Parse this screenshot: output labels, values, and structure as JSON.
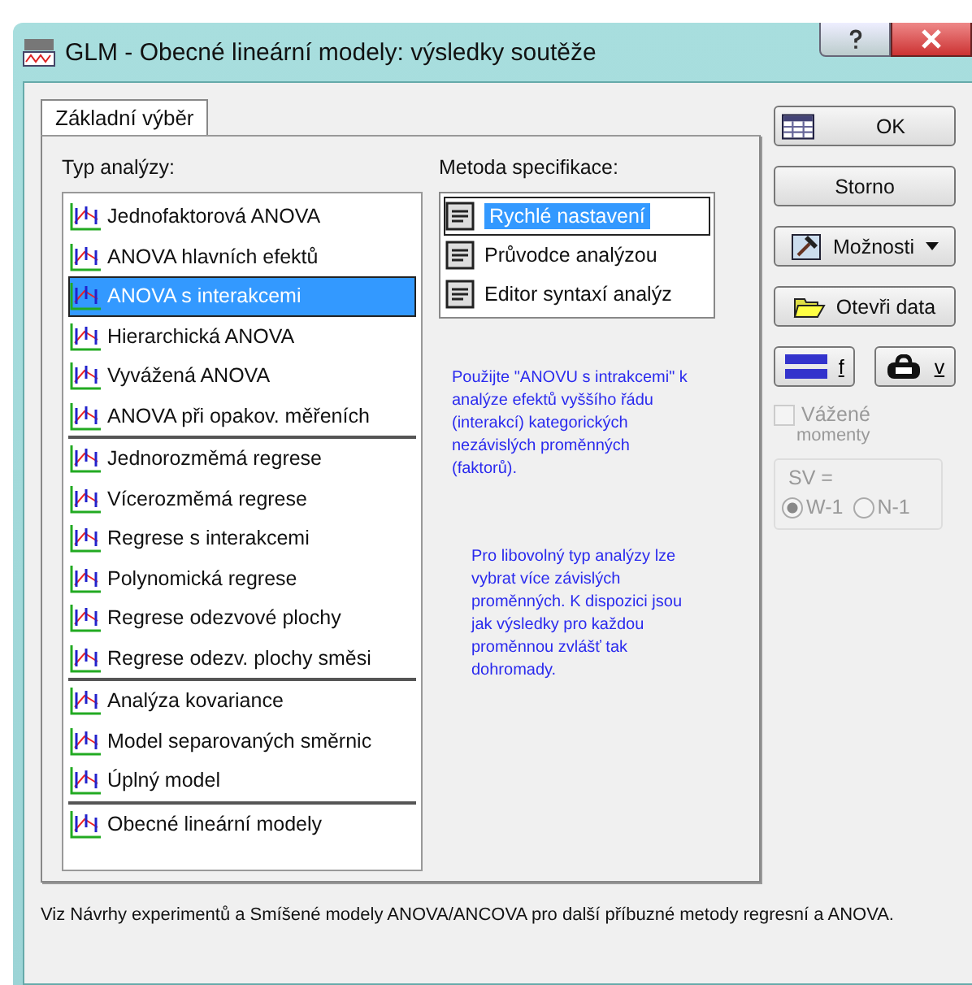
{
  "window": {
    "title": "GLM - Obecné lineární modely: výsledky soutěže"
  },
  "tabs": [
    {
      "label": "Základní výběr",
      "selected": true
    }
  ],
  "analysis_type": {
    "label": "Typ analýzy:",
    "groups": [
      [
        {
          "label": "Jednofaktorová ANOVA",
          "selected": false
        },
        {
          "label": "ANOVA hlavních efektů",
          "selected": false
        },
        {
          "label": "ANOVA s interakcemi",
          "selected": true
        },
        {
          "label": "Hierarchická ANOVA",
          "selected": false
        },
        {
          "label": "Vyvážená ANOVA",
          "selected": false
        },
        {
          "label": "ANOVA při opakov. měřeních",
          "selected": false
        }
      ],
      [
        {
          "label": "Jednorozměmá regrese",
          "selected": false
        },
        {
          "label": "Vícerozměmá regrese",
          "selected": false
        },
        {
          "label": "Regrese s interakcemi",
          "selected": false
        },
        {
          "label": "Polynomická regrese",
          "selected": false
        },
        {
          "label": "Regrese odezvové plochy",
          "selected": false
        },
        {
          "label": "Regrese odezv. plochy směsi",
          "selected": false
        }
      ],
      [
        {
          "label": "Analýza kovariance",
          "selected": false
        },
        {
          "label": "Model separovaných směrnic",
          "selected": false
        },
        {
          "label": "Úplný model",
          "selected": false
        }
      ],
      [
        {
          "label": "Obecné lineární modely",
          "selected": false
        }
      ]
    ]
  },
  "specification": {
    "label": "Metoda specifikace:",
    "items": [
      {
        "label": "Rychlé nastavení",
        "selected": true
      },
      {
        "label": "Průvodce analýzou",
        "selected": false
      },
      {
        "label": "Editor syntaxí analýz",
        "selected": false
      }
    ]
  },
  "hints": [
    "Použijte \"ANOVU s intrakcemi\" k analýze efektů vyššího řádu (interakcí) kategorických nezávislých proměnných (faktorů).",
    "Pro libovolný typ analýzy lze vybrat více závislých proměnných. K dispozici jsou jak výsledky pro každou proměnnou zvlášť tak dohromady."
  ],
  "buttons": {
    "ok": "OK",
    "cancel": "Storno",
    "options": "Možnosti",
    "open_data": "Otevři data",
    "select_cases": "f",
    "weights": "v"
  },
  "weighted_moments": {
    "label": "Vážené",
    "sublabel": "momenty",
    "checked": false,
    "disabled": true
  },
  "sv": {
    "label": "SV =",
    "disabled": true,
    "options": [
      {
        "label": "W-1",
        "selected": true
      },
      {
        "label": "N-1",
        "selected": false
      }
    ]
  },
  "footer": "Viz Návrhy experimentů a Smíšené modely ANOVA/ANCOVA pro další příbuzné metody regresní a ANOVA."
}
